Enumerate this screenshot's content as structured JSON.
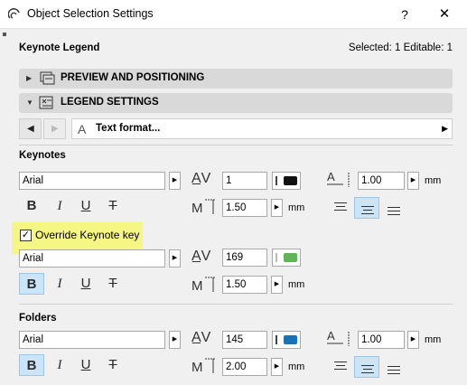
{
  "window": {
    "title": "Object Selection Settings",
    "help_glyph": "?",
    "close_glyph": "✕"
  },
  "header": {
    "object_name": "Keynote Legend",
    "selection_info": "Selected: 1 Editable: 1"
  },
  "sections": {
    "preview": "PREVIEW AND POSITIONING",
    "legend": "LEGEND SETTINGS"
  },
  "nav": {
    "page_label": "Text format..."
  },
  "keynotes": {
    "label": "Keynotes",
    "font": "Arial",
    "pen": "1",
    "pen_color": "#111111",
    "spacing": "1.00",
    "size": "1.50",
    "unit": "mm"
  },
  "override": {
    "label": "Override Keynote key",
    "checked": true,
    "font": "Arial",
    "pen": "169",
    "pen_color": "#5fb556",
    "size": "1.50",
    "unit": "mm"
  },
  "folders": {
    "label": "Folders",
    "font": "Arial",
    "pen": "145",
    "pen_color": "#1a72b6",
    "spacing": "1.00",
    "size": "2.00",
    "unit": "mm"
  },
  "icons": {
    "bold": "B",
    "italic": "I",
    "underline": "U",
    "strike": "T"
  }
}
